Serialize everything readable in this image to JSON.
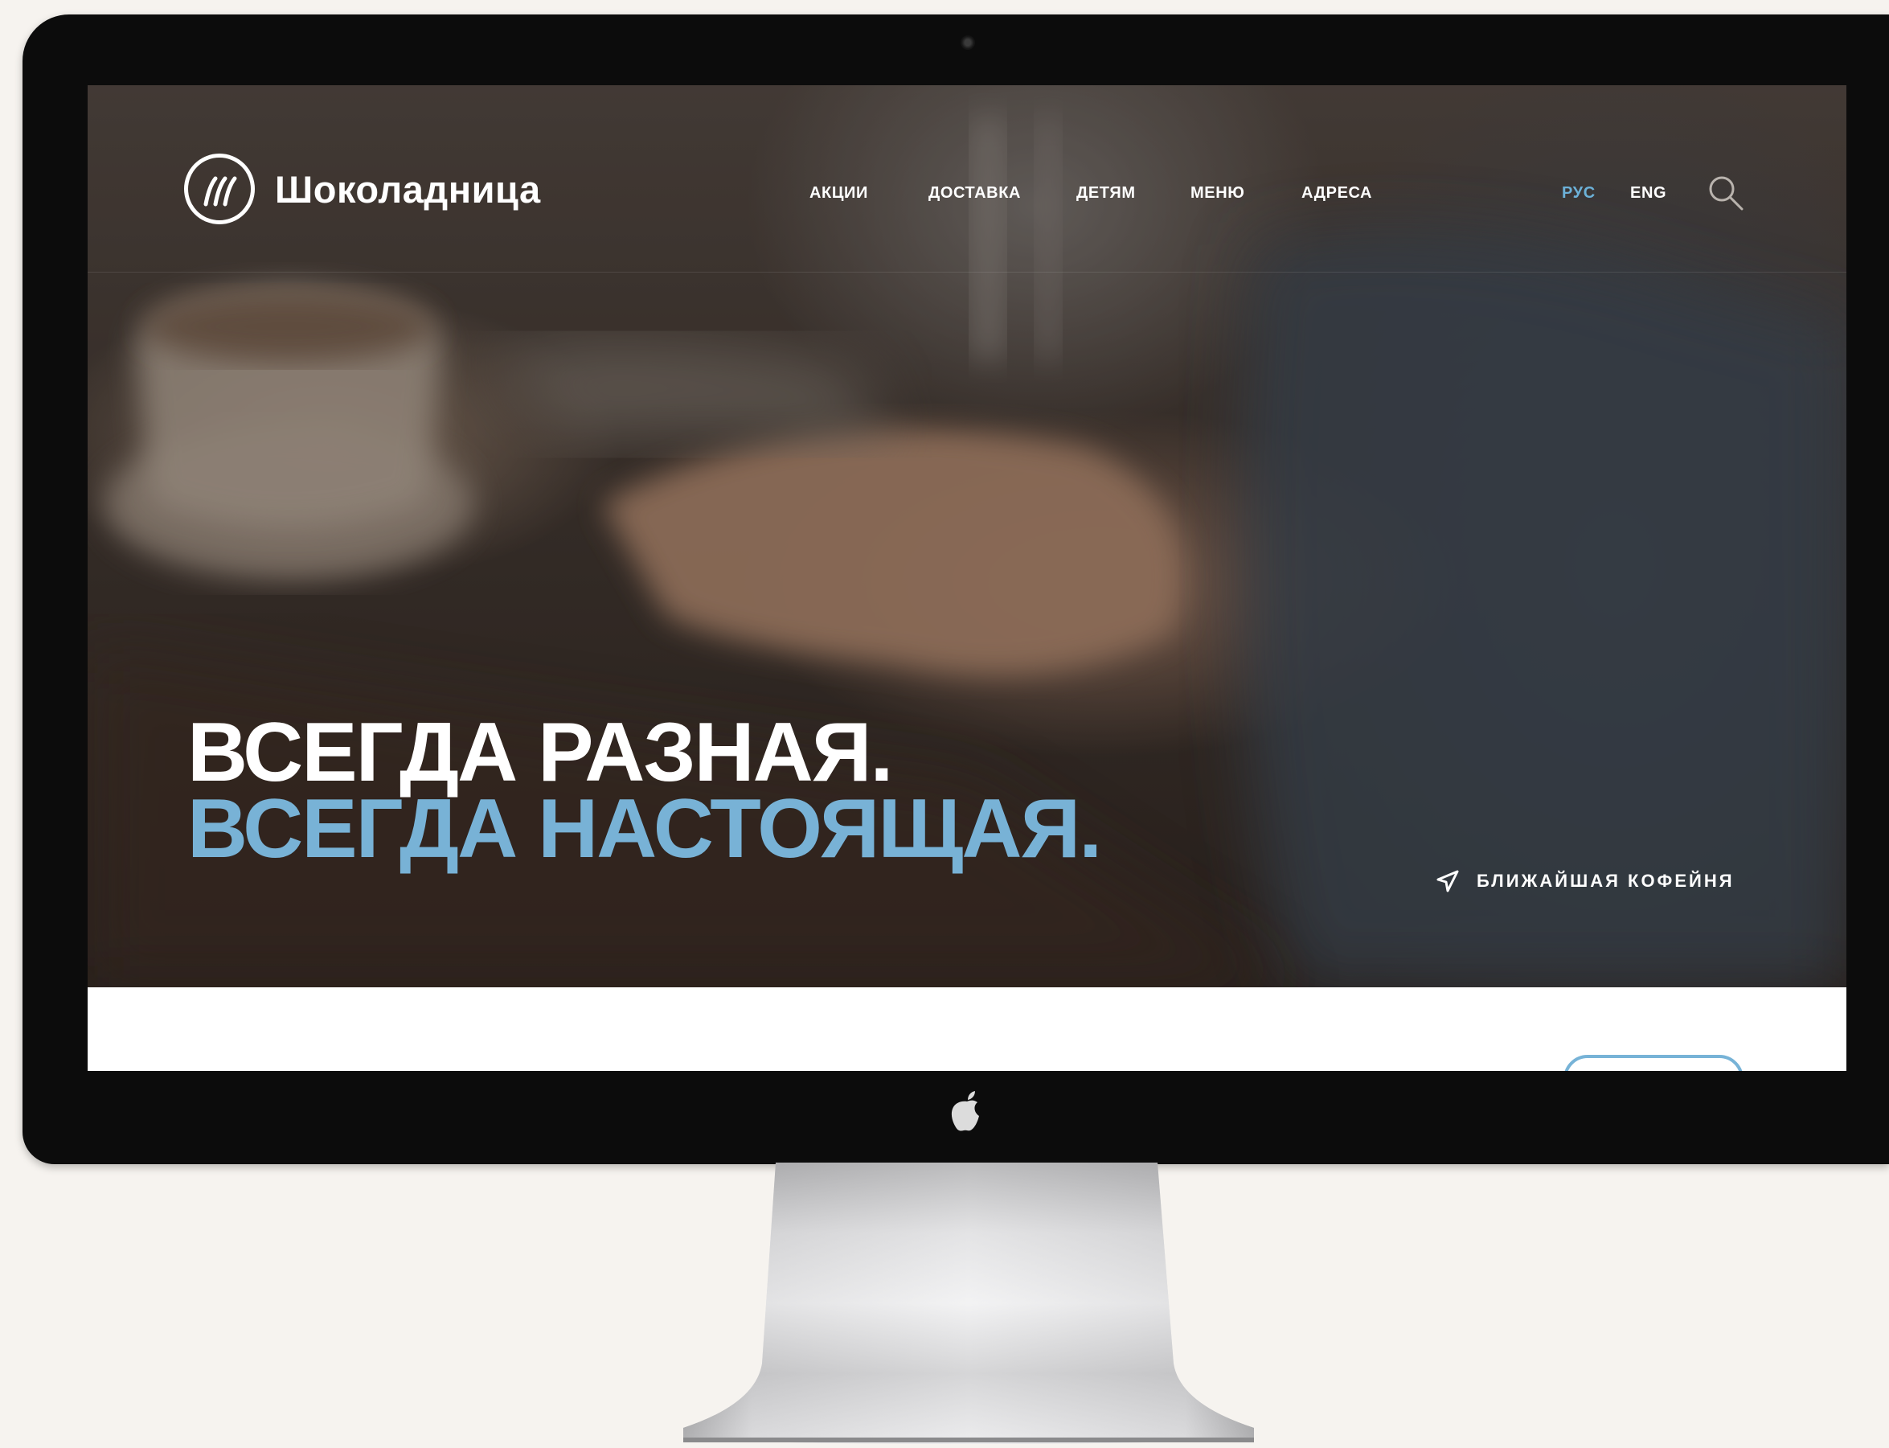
{
  "site": {
    "brand": "Шоколадница",
    "logo_icon": "three-waves-logo-icon"
  },
  "nav": {
    "items": [
      "АКЦИИ",
      "ДОСТАВКА",
      "ДЕТЯМ",
      "МЕНЮ",
      "АДРЕСА"
    ]
  },
  "lang": {
    "ru": "РУС",
    "en": "ENG",
    "active": "ru"
  },
  "hero": {
    "headline_line1": "ВСЕГДА РАЗНАЯ.",
    "headline_line2": "ВСЕГДА НАСТОЯЩАЯ.",
    "nearest_cafe": "БЛИЖАЙШАЯ КОФЕЙНЯ"
  },
  "colors": {
    "accent": "#78b2d6",
    "bezel": "#0c0c0c",
    "page_background": "#f6f3ef"
  }
}
